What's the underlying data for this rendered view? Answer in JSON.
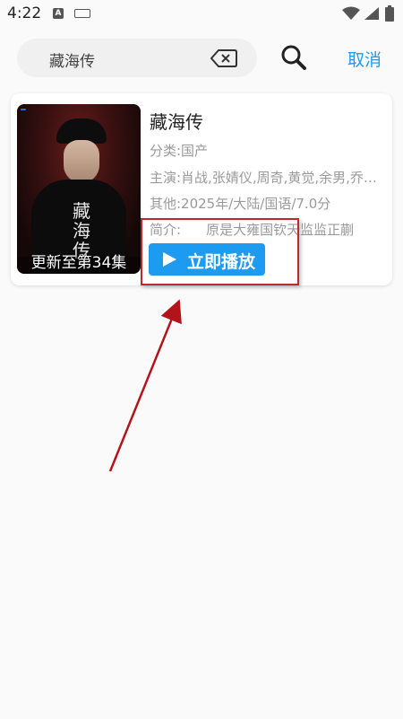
{
  "status_bar": {
    "time": "4:22",
    "icons": [
      "a-notification-icon",
      "keyboard-icon",
      "wifi-icon",
      "signal-icon",
      "battery-icon"
    ]
  },
  "search": {
    "query": "藏海传",
    "cancel_label": "取消"
  },
  "result": {
    "title": "藏海传",
    "category": "分类:国产",
    "cast": "主演:肖战,张婧仪,周奇,黄觉,余男,乔振宇,郭",
    "other": "其他:2025年/大陆/国语/7.0分",
    "intro_label": "简介:",
    "intro_text": "原是大雍国钦天监监正蒯",
    "play_label": "立即播放",
    "poster": {
      "update_text": "更新至第34集",
      "title_text": "藏海传"
    }
  },
  "colors": {
    "accent": "#1d9bf0",
    "annotation": "#c0282e"
  }
}
